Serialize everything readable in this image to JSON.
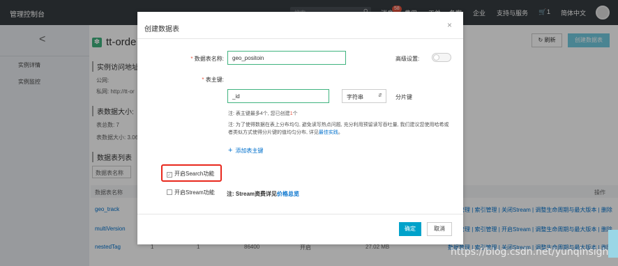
{
  "topbar": {
    "brand": "管理控制台",
    "search_placeholder": "搜索",
    "nav": [
      "消息",
      "费用",
      "工单",
      "备案",
      "企业",
      "支持与服务",
      "1",
      "简体中文"
    ],
    "message_badge": "58"
  },
  "leftnav": {
    "back": "<",
    "items": [
      "实例详情",
      "实例监控"
    ]
  },
  "background": {
    "page_title": "tt-orde",
    "refresh": "刷新",
    "create_table": "创建数据表",
    "section_access": "实例访问地址",
    "public": "公网:",
    "private": "私网: http://tt-or",
    "section_size": "表数据大小:",
    "table_count": "表总数: 7",
    "table_size": "表数据大小: 3.06",
    "section_list": "数据表列表",
    "filter_select": "数据表名称",
    "col_name": "数据表名称",
    "col_ops": "操作",
    "rows": [
      {
        "name": "geo_track",
        "ops": "管理 | 索引管理 | 关闭Stream | 调整生命周期与最大版本 | 删除"
      },
      {
        "name": "multiVersion",
        "ops": "管理 | 索引管理 | 开启Stream | 调整生命周期与最大版本 | 删除"
      },
      {
        "name": "nestedTag",
        "ops": "数据管理 | 索引管理 | 关闭Stream | 调整生命周期与最大版本 | 删除",
        "c1": "1",
        "c2": "1",
        "c3": "86400",
        "c4": "开启",
        "c5": "27.02 MB"
      }
    ]
  },
  "modal": {
    "title": "创建数据表",
    "close": "×",
    "table_name_label": "数据表名称:",
    "table_name_value": "geo_positoin",
    "advanced_label": "高级设置:",
    "pk_label": "表主键:",
    "pk_value": "_id",
    "pk_type": "字符串",
    "partition_key": "分片键",
    "note1_prefix": "注: 表主键最多4个, 您已创建",
    "note1_count": "1",
    "note1_suffix": "个",
    "note2": "注: 为了使得数据在表上分布均匀, 避免读写热点问题, 充分利用预留读写吞吐量, 我们建议您使用哈希或者类似方式使得分片键的值均匀分布, 详见",
    "note2_link": "最佳实践",
    "note2_end": "。",
    "add_pk": "添加表主键",
    "search_check": "开启Search功能",
    "stream_check": "开启Stream功能",
    "stream_note": "注: Stream资费详见",
    "stream_link": "价格总览",
    "ok": "确定",
    "cancel": "取消"
  },
  "watermark": "https://blog.csdn.net/yunqinsigh",
  "colors": {
    "accent": "#00a2ca",
    "highlight": "#e8271c",
    "input_border": "#3fb37e"
  }
}
